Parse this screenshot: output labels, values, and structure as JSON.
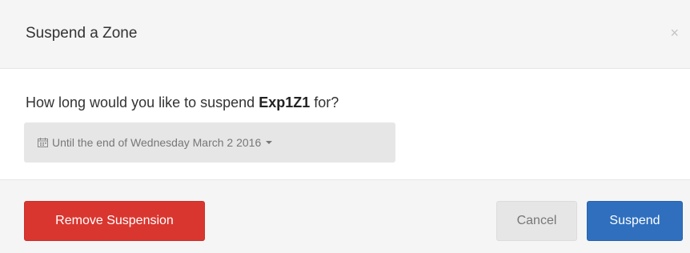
{
  "dialog": {
    "title": "Suspend a Zone",
    "close_symbol": "×"
  },
  "body": {
    "prompt_before": "How long would you like to suspend ",
    "zone_name": "Exp1Z1",
    "prompt_after": " for?",
    "duration_dropdown": {
      "icon": "calendar-icon",
      "selected_value": "Until the end of Wednesday March 2 2016"
    }
  },
  "footer": {
    "remove_label": "Remove Suspension",
    "cancel_label": "Cancel",
    "suspend_label": "Suspend"
  },
  "colors": {
    "danger": "#d9362f",
    "primary": "#2f6fbe",
    "header_bg": "#f5f5f5"
  }
}
